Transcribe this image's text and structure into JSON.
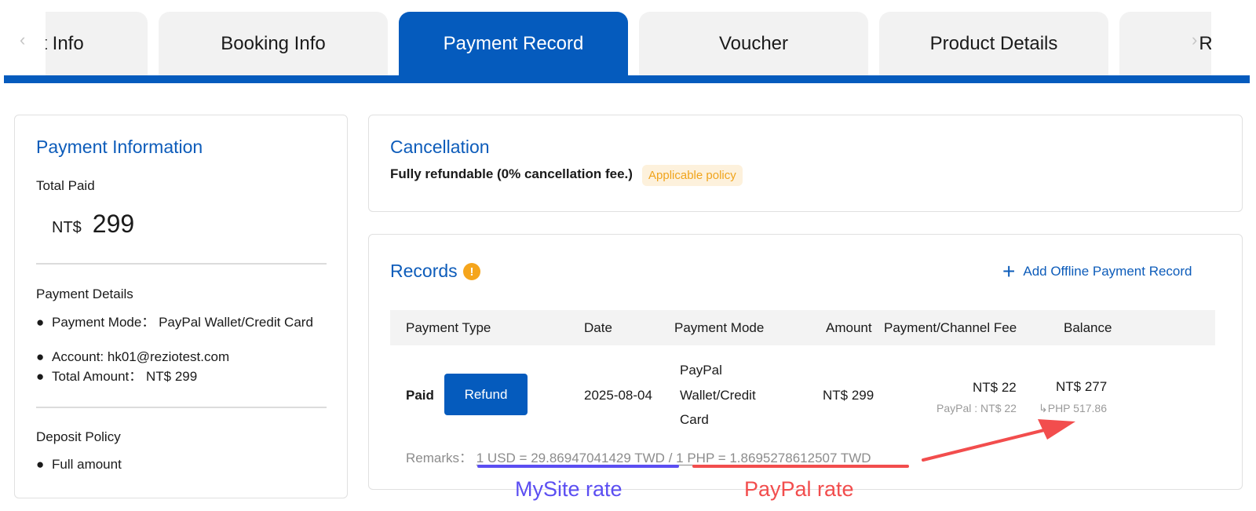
{
  "tabs": {
    "items": [
      {
        "label": "Contact Info",
        "active": false
      },
      {
        "label": "Booking Info",
        "active": false
      },
      {
        "label": "Payment Record",
        "active": true
      },
      {
        "label": "Voucher",
        "active": false
      },
      {
        "label": "Product Details",
        "active": false
      },
      {
        "label": "Records",
        "active": false
      }
    ],
    "prev_icon": "chevron-left-icon",
    "next_icon": "chevron-right-icon",
    "prev_glyph": "‹",
    "next_glyph": "›"
  },
  "payment_info": {
    "title": "Payment Information",
    "total_paid_label": "Total Paid",
    "currency": "NT$",
    "total_paid_value": "299",
    "details_label": "Payment Details",
    "details": [
      {
        "label": "Payment Mode：",
        "value": "PayPal Wallet/Credit Card"
      },
      {
        "label": "Account:",
        "value": "hk01@reziotest.com"
      },
      {
        "label": "Total Amount：",
        "value": "NT$ 299"
      }
    ],
    "deposit_label": "Deposit Policy",
    "deposit_items": [
      "Full amount"
    ]
  },
  "cancellation": {
    "title": "Cancellation",
    "policy_text": "Fully refundable (0% cancellation fee.)",
    "badge": "Applicable policy"
  },
  "records": {
    "title": "Records",
    "warn_glyph": "!",
    "add_label": "Add Offline Payment Record",
    "add_glyph": "+",
    "columns": [
      "Payment Type",
      "Date",
      "Payment Mode",
      "Amount",
      "Payment/Channel Fee",
      "Balance"
    ],
    "rows": [
      {
        "type": "Paid",
        "refund_label": "Refund",
        "date": "2025-08-04",
        "mode_lines": [
          "PayPal",
          "Wallet/Credit",
          "Card"
        ],
        "amount": "NT$ 299",
        "fee": "NT$ 22",
        "fee_sub": "PayPal : NT$ 22",
        "balance": "NT$ 277",
        "balance_sub": "↳PHP 517.86"
      }
    ],
    "remarks_label": "Remarks：",
    "rate_usd": "1 USD = 29.86947041429 TWD",
    "separator": "/",
    "rate_php": "1 PHP = 1.8695278612507 TWD"
  },
  "annotations": {
    "mysite_label": "MySite rate",
    "paypal_label": "PayPal rate",
    "mysite_color": "#5b4ef2",
    "paypal_color": "#f24d4d"
  },
  "colors": {
    "primary": "#055bbd",
    "title_blue": "#0d5cba",
    "warning": "#f5a51c"
  }
}
